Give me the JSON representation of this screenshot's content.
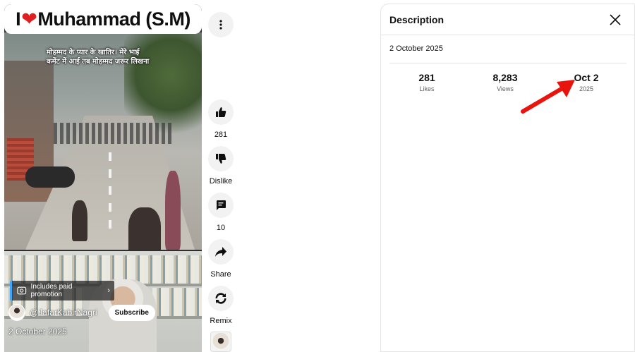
{
  "video": {
    "title_prefix": "I",
    "title_heart": "❤",
    "title_main": "Muhammad (S.M)",
    "overlay_caption_line1": "मोहम्मद के प्यार के खातिर। मेरे भाई",
    "overlay_caption_line2": "कमेंट में आई तब मोहम्मद जरूर लिखना",
    "paid_promotion_label": "Includes paid promotion",
    "channel_name": "@JafarKabirNagri",
    "subscribe_label": "Subscribe",
    "date": "2 October 2025"
  },
  "actions": {
    "menu_icon": "more-vert-icon",
    "like_count": "281",
    "dislike_label": "Dislike",
    "comment_count": "10",
    "share_label": "Share",
    "remix_label": "Remix"
  },
  "description_panel": {
    "title": "Description",
    "date": "2 October 2025",
    "stats": [
      {
        "value": "281",
        "caption": "Likes"
      },
      {
        "value": "8,283",
        "caption": "Views"
      },
      {
        "value": "Oct 2",
        "caption": "2025"
      }
    ]
  },
  "colors": {
    "annotation_arrow": "#e8140e",
    "heart": "#e02020",
    "promo_accent": "#3ea6ff"
  }
}
